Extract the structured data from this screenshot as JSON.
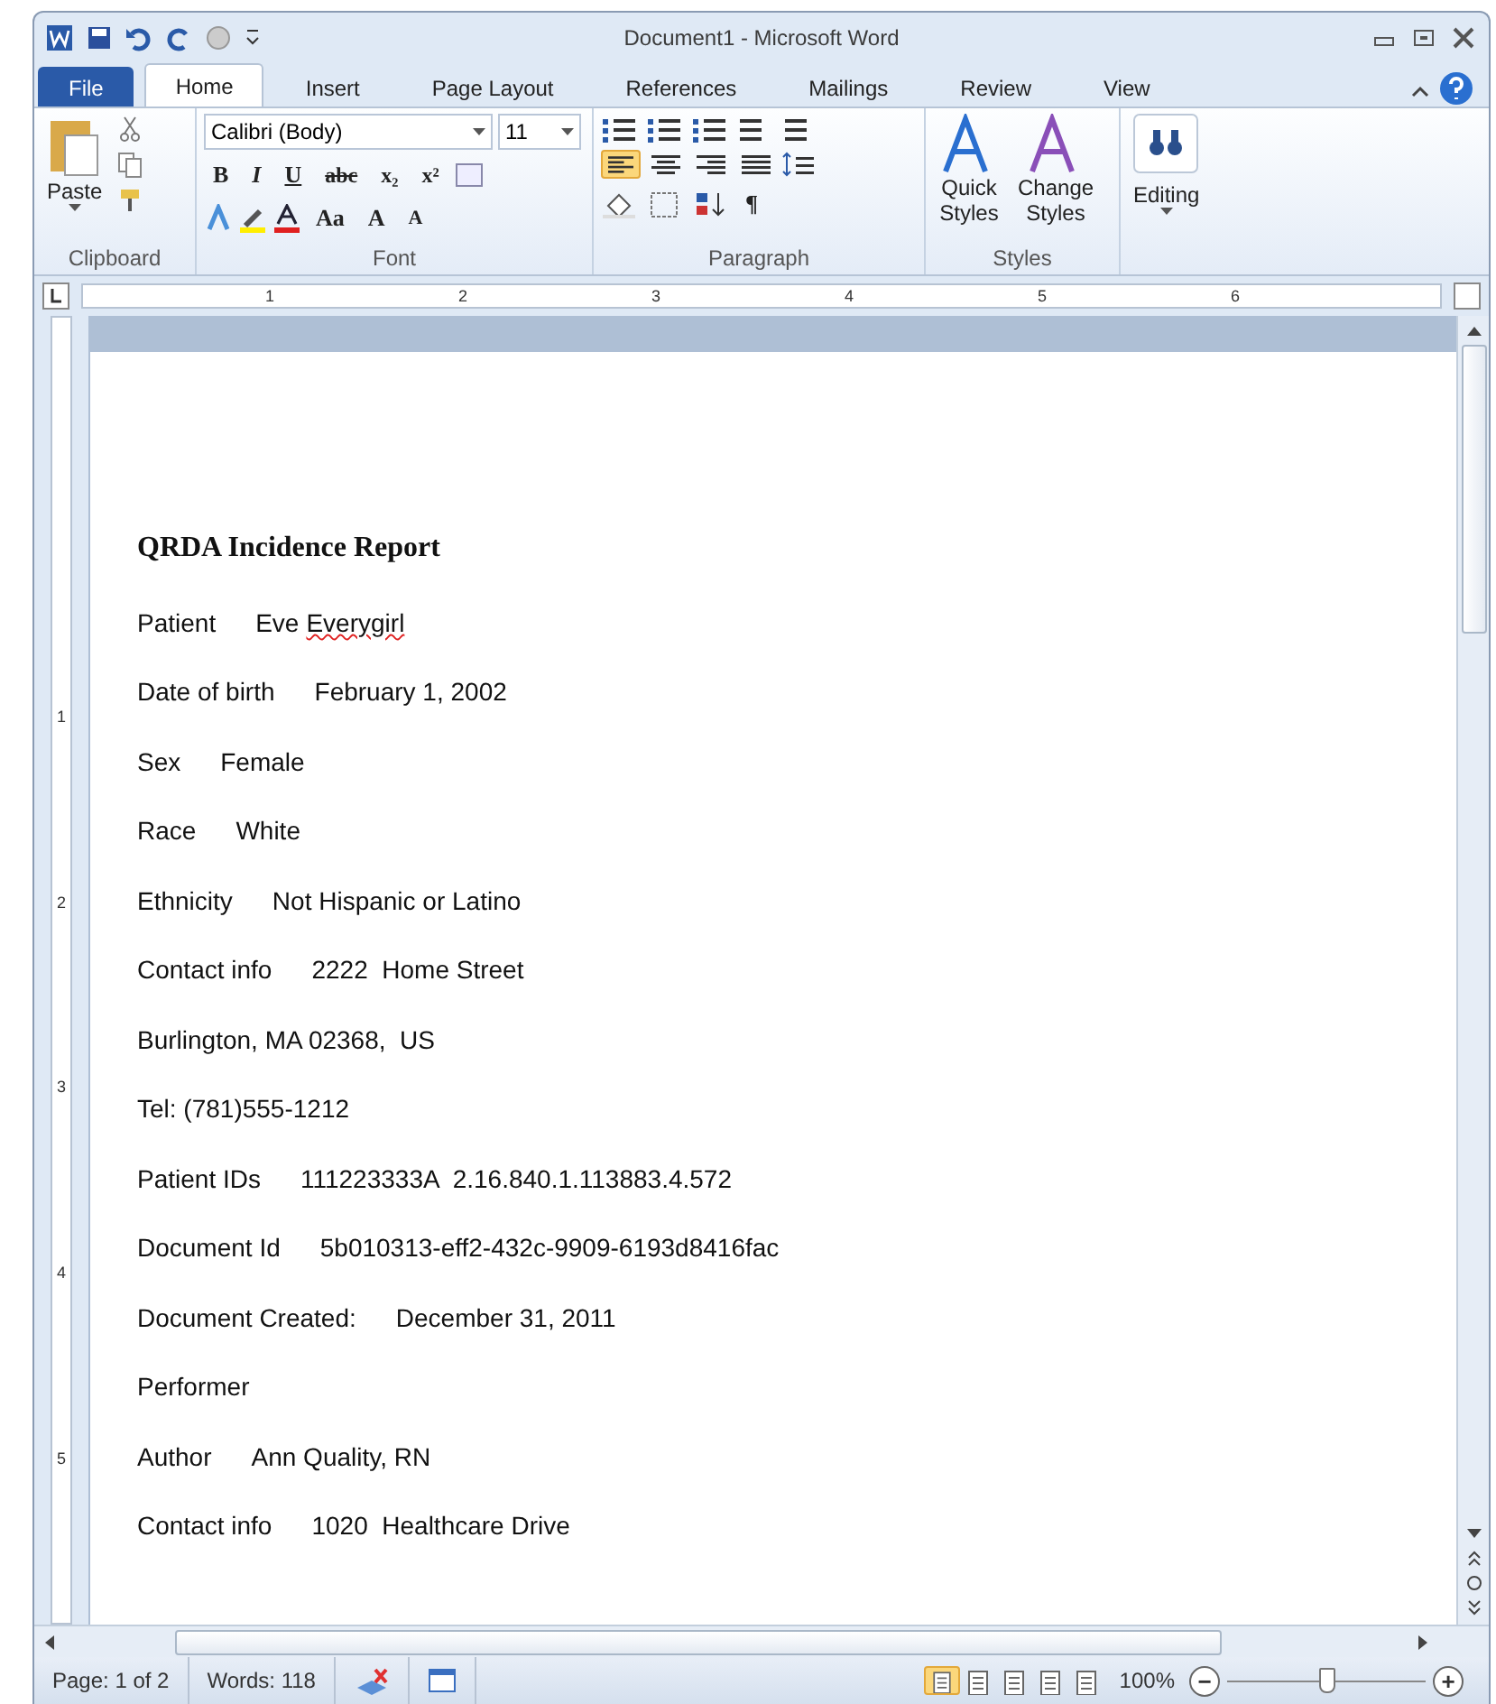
{
  "window": {
    "title": "Document1  -  Microsoft Word"
  },
  "tabs": [
    {
      "label": "File",
      "kind": "file",
      "selected": false
    },
    {
      "label": "Home",
      "kind": "tab",
      "selected": true
    },
    {
      "label": "Insert",
      "kind": "tab",
      "selected": false
    },
    {
      "label": "Page Layout",
      "kind": "tab",
      "selected": false
    },
    {
      "label": "References",
      "kind": "tab",
      "selected": false
    },
    {
      "label": "Mailings",
      "kind": "tab",
      "selected": false
    },
    {
      "label": "Review",
      "kind": "tab",
      "selected": false
    },
    {
      "label": "View",
      "kind": "tab",
      "selected": false
    }
  ],
  "ribbon": {
    "clipboard": {
      "label": "Clipboard",
      "paste": "Paste"
    },
    "font": {
      "label": "Font",
      "font_name": "Calibri (Body)",
      "font_size": "11",
      "format_buttons": [
        "B",
        "I",
        "U",
        "abc",
        "x₂",
        "x²"
      ],
      "size_buttons": [
        "Aa",
        "A",
        "A"
      ]
    },
    "paragraph": {
      "label": "Paragraph",
      "alignments": [
        {
          "selected": true
        },
        {
          "selected": false
        },
        {
          "selected": false
        },
        {
          "selected": false
        }
      ],
      "pilcrow": "¶"
    },
    "styles": {
      "label": "Styles",
      "buttons": [
        {
          "line1": "Quick",
          "line2": "Styles"
        },
        {
          "line1": "Change",
          "line2": "Styles"
        }
      ]
    },
    "editing": {
      "label": "Editing"
    }
  },
  "ruler": {
    "numbers": [
      "1",
      "2",
      "3",
      "4",
      "5",
      "6"
    ]
  },
  "vertical_ruler": {
    "numbers": [
      "1",
      "2",
      "3",
      "4",
      "5"
    ]
  },
  "document": {
    "title": "QRDA Incidence Report",
    "lines": [
      {
        "parts": [
          {
            "text": "Patient",
            "misspelled": false
          },
          {
            "text": "Eve",
            "misspelled": false
          },
          {
            "text": "Everygirl",
            "misspelled": true
          }
        ]
      },
      {
        "parts": [
          {
            "text": "Date of birth",
            "misspelled": false
          },
          {
            "text": "February 1, 2002",
            "misspelled": false
          }
        ]
      },
      {
        "parts": [
          {
            "text": "Sex",
            "misspelled": false
          },
          {
            "text": "Female",
            "misspelled": false
          }
        ]
      },
      {
        "parts": [
          {
            "text": "Race",
            "misspelled": false
          },
          {
            "text": "White",
            "misspelled": false
          }
        ]
      },
      {
        "parts": [
          {
            "text": "Ethnicity",
            "misspelled": false
          },
          {
            "text": "Not Hispanic or Latino",
            "misspelled": false
          }
        ]
      },
      {
        "parts": [
          {
            "text": "Contact info",
            "misspelled": false
          },
          {
            "text": "2222  Home Street",
            "misspelled": false
          }
        ]
      },
      {
        "parts": [
          {
            "text": "Burlington, MA 02368,  US",
            "misspelled": false
          }
        ]
      },
      {
        "parts": [
          {
            "text": "Tel: (781)555-1212",
            "misspelled": false
          }
        ]
      },
      {
        "parts": [
          {
            "text": "Patient IDs",
            "misspelled": false
          },
          {
            "text": "111223333A  2.16.840.1.113883.4.572",
            "misspelled": false
          }
        ]
      },
      {
        "parts": [
          {
            "text": "Document Id",
            "misspelled": false
          },
          {
            "text": "5b010313-eff2-432c-9909-6193d8416fac",
            "misspelled": false
          }
        ]
      },
      {
        "parts": [
          {
            "text": "Document Created:",
            "misspelled": false
          },
          {
            "text": "December 31, 2011",
            "misspelled": false
          }
        ]
      },
      {
        "parts": [
          {
            "text": "Performer",
            "misspelled": false
          }
        ]
      },
      {
        "parts": [
          {
            "text": "Author",
            "misspelled": false
          },
          {
            "text": "Ann Quality, RN",
            "misspelled": false
          }
        ]
      },
      {
        "parts": [
          {
            "text": "Contact info",
            "misspelled": false
          },
          {
            "text": "1020  Healthcare Drive",
            "misspelled": false
          }
        ]
      }
    ]
  },
  "status_bar": {
    "page": "Page: 1 of 2",
    "words": "Words: 118",
    "views": [
      {
        "selected": true
      },
      {
        "selected": false
      },
      {
        "selected": false
      },
      {
        "selected": false
      },
      {
        "selected": false
      }
    ],
    "zoom": "100%",
    "zoom_minus": "−",
    "zoom_plus": "+",
    "zoom_slider": {
      "level": 0.5
    }
  }
}
